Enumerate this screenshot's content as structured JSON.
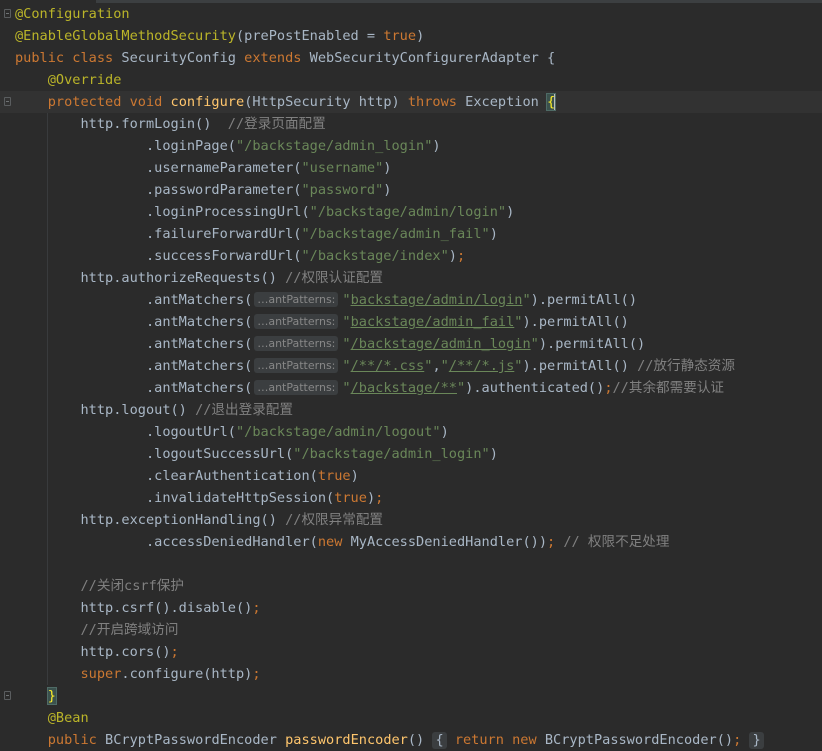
{
  "lines": [
    {
      "fold": true,
      "tokens": [
        {
          "c": "ann",
          "t": "@Configuration"
        }
      ]
    },
    {
      "fold": false,
      "tokens": [
        {
          "c": "ann",
          "t": "@EnableGlobalMethodSecurity"
        },
        {
          "c": "",
          "t": "(prePostEnabled = "
        },
        {
          "c": "kw",
          "t": "true"
        },
        {
          "c": "",
          "t": ")"
        }
      ]
    },
    {
      "fold": false,
      "tokens": [
        {
          "c": "kw",
          "t": "public class "
        },
        {
          "c": "",
          "t": "SecurityConfig "
        },
        {
          "c": "kw",
          "t": "extends "
        },
        {
          "c": "",
          "t": "WebSecurityConfigurerAdapter {"
        }
      ]
    },
    {
      "fold": false,
      "tokens": [
        {
          "c": "",
          "t": "    "
        },
        {
          "c": "ann",
          "t": "@Override"
        }
      ]
    },
    {
      "fold": true,
      "current": true,
      "tokens": [
        {
          "c": "",
          "t": "    "
        },
        {
          "c": "kw",
          "t": "protected void "
        },
        {
          "c": "fn",
          "t": "configure"
        },
        {
          "c": "",
          "t": "(HttpSecurity http) "
        },
        {
          "c": "kw",
          "t": "throws "
        },
        {
          "c": "",
          "t": "Exception "
        },
        {
          "c": "bracket-hl",
          "t": "{"
        }
      ]
    },
    {
      "fold": false,
      "tokens": [
        {
          "c": "",
          "t": "        http.formLogin()  "
        },
        {
          "c": "cmt",
          "t": "//登录页面配置"
        }
      ]
    },
    {
      "fold": false,
      "tokens": [
        {
          "c": "",
          "t": "                .loginPage("
        },
        {
          "c": "str",
          "t": "\"/backstage/admin_login\""
        },
        {
          "c": "",
          "t": ")"
        }
      ]
    },
    {
      "fold": false,
      "tokens": [
        {
          "c": "",
          "t": "                .usernameParameter("
        },
        {
          "c": "str",
          "t": "\"username\""
        },
        {
          "c": "",
          "t": ")"
        }
      ]
    },
    {
      "fold": false,
      "tokens": [
        {
          "c": "",
          "t": "                .passwordParameter("
        },
        {
          "c": "str",
          "t": "\"password\""
        },
        {
          "c": "",
          "t": ")"
        }
      ]
    },
    {
      "fold": false,
      "tokens": [
        {
          "c": "",
          "t": "                .loginProcessingUrl("
        },
        {
          "c": "str",
          "t": "\"/backstage/admin/login\""
        },
        {
          "c": "",
          "t": ")"
        }
      ]
    },
    {
      "fold": false,
      "tokens": [
        {
          "c": "",
          "t": "                .failureForwardUrl("
        },
        {
          "c": "str",
          "t": "\"/backstage/admin_fail\""
        },
        {
          "c": "",
          "t": ")"
        }
      ]
    },
    {
      "fold": false,
      "tokens": [
        {
          "c": "",
          "t": "                .successForwardUrl("
        },
        {
          "c": "str",
          "t": "\"/backstage/index\""
        },
        {
          "c": "",
          "t": ")"
        },
        {
          "c": "kw",
          "t": ";"
        }
      ]
    },
    {
      "fold": false,
      "tokens": [
        {
          "c": "",
          "t": "        http.authorizeRequests() "
        },
        {
          "c": "cmt",
          "t": "//权限认证配置"
        }
      ]
    },
    {
      "fold": false,
      "tokens": [
        {
          "c": "",
          "t": "                .antMatchers("
        },
        {
          "c": "hint",
          "t": "…antPatterns:"
        },
        {
          "c": "str",
          "t": "\""
        },
        {
          "c": "link",
          "t": "backstage/admin/login"
        },
        {
          "c": "str",
          "t": "\""
        },
        {
          "c": "",
          "t": ").permitAll()"
        }
      ]
    },
    {
      "fold": false,
      "tokens": [
        {
          "c": "",
          "t": "                .antMatchers("
        },
        {
          "c": "hint",
          "t": "…antPatterns:"
        },
        {
          "c": "str",
          "t": "\""
        },
        {
          "c": "link",
          "t": "backstage/admin_fail"
        },
        {
          "c": "str",
          "t": "\""
        },
        {
          "c": "",
          "t": ").permitAll()"
        }
      ]
    },
    {
      "fold": false,
      "tokens": [
        {
          "c": "",
          "t": "                .antMatchers("
        },
        {
          "c": "hint",
          "t": "…antPatterns:"
        },
        {
          "c": "str",
          "t": "\""
        },
        {
          "c": "link",
          "t": "/backstage/admin_login"
        },
        {
          "c": "str",
          "t": "\""
        },
        {
          "c": "",
          "t": ").permitAll()"
        }
      ]
    },
    {
      "fold": false,
      "tokens": [
        {
          "c": "",
          "t": "                .antMatchers("
        },
        {
          "c": "hint",
          "t": "…antPatterns:"
        },
        {
          "c": "str",
          "t": "\""
        },
        {
          "c": "link",
          "t": "/**/*.css"
        },
        {
          "c": "str",
          "t": "\""
        },
        {
          "c": "",
          "t": ","
        },
        {
          "c": "str",
          "t": "\""
        },
        {
          "c": "link",
          "t": "/**/*.js"
        },
        {
          "c": "str",
          "t": "\""
        },
        {
          "c": "",
          "t": ").permitAll() "
        },
        {
          "c": "cmt",
          "t": "//放行静态资源"
        }
      ]
    },
    {
      "fold": false,
      "tokens": [
        {
          "c": "",
          "t": "                .antMatchers("
        },
        {
          "c": "hint",
          "t": "…antPatterns:"
        },
        {
          "c": "str",
          "t": "\""
        },
        {
          "c": "link",
          "t": "/backstage/**"
        },
        {
          "c": "str",
          "t": "\""
        },
        {
          "c": "",
          "t": ").authenticated()"
        },
        {
          "c": "kw",
          "t": ";"
        },
        {
          "c": "cmt",
          "t": "//其余都需要认证"
        }
      ]
    },
    {
      "fold": false,
      "tokens": [
        {
          "c": "",
          "t": "        http.logout() "
        },
        {
          "c": "cmt",
          "t": "//退出登录配置"
        }
      ]
    },
    {
      "fold": false,
      "tokens": [
        {
          "c": "",
          "t": "                .logoutUrl("
        },
        {
          "c": "str",
          "t": "\"/backstage/admin/logout\""
        },
        {
          "c": "",
          "t": ")"
        }
      ]
    },
    {
      "fold": false,
      "tokens": [
        {
          "c": "",
          "t": "                .logoutSuccessUrl("
        },
        {
          "c": "str",
          "t": "\"/backstage/admin_login\""
        },
        {
          "c": "",
          "t": ")"
        }
      ]
    },
    {
      "fold": false,
      "tokens": [
        {
          "c": "",
          "t": "                .clearAuthentication("
        },
        {
          "c": "kw",
          "t": "true"
        },
        {
          "c": "",
          "t": ")"
        }
      ]
    },
    {
      "fold": false,
      "tokens": [
        {
          "c": "",
          "t": "                .invalidateHttpSession("
        },
        {
          "c": "kw",
          "t": "true"
        },
        {
          "c": "",
          "t": ")"
        },
        {
          "c": "kw",
          "t": ";"
        }
      ]
    },
    {
      "fold": false,
      "tokens": [
        {
          "c": "",
          "t": "        http.exceptionHandling() "
        },
        {
          "c": "cmt",
          "t": "//权限异常配置"
        }
      ]
    },
    {
      "fold": false,
      "tokens": [
        {
          "c": "",
          "t": "                .accessDeniedHandler("
        },
        {
          "c": "kw",
          "t": "new "
        },
        {
          "c": "",
          "t": "MyAccessDeniedHandler())"
        },
        {
          "c": "kw",
          "t": "; "
        },
        {
          "c": "cmt",
          "t": "// 权限不足处理"
        }
      ]
    },
    {
      "fold": false,
      "tokens": [
        {
          "c": "",
          "t": ""
        }
      ]
    },
    {
      "fold": false,
      "tokens": [
        {
          "c": "",
          "t": "        "
        },
        {
          "c": "cmt",
          "t": "//关闭csrf保护"
        }
      ]
    },
    {
      "fold": false,
      "tokens": [
        {
          "c": "",
          "t": "        http.csrf().disable()"
        },
        {
          "c": "kw",
          "t": ";"
        }
      ]
    },
    {
      "fold": false,
      "tokens": [
        {
          "c": "",
          "t": "        "
        },
        {
          "c": "cmt",
          "t": "//开启跨域访问"
        }
      ]
    },
    {
      "fold": false,
      "tokens": [
        {
          "c": "",
          "t": "        http.cors()"
        },
        {
          "c": "kw",
          "t": ";"
        }
      ]
    },
    {
      "fold": false,
      "tokens": [
        {
          "c": "",
          "t": "        "
        },
        {
          "c": "kw",
          "t": "super"
        },
        {
          "c": "",
          "t": ".configure(http)"
        },
        {
          "c": "kw",
          "t": ";"
        }
      ]
    },
    {
      "fold": true,
      "tokens": [
        {
          "c": "",
          "t": "    "
        },
        {
          "c": "bracket-hl",
          "t": "}"
        }
      ]
    },
    {
      "fold": false,
      "tokens": [
        {
          "c": "",
          "t": "    "
        },
        {
          "c": "ann",
          "t": "@Bean"
        }
      ]
    },
    {
      "fold": false,
      "tokens": [
        {
          "c": "",
          "t": "    "
        },
        {
          "c": "kw",
          "t": "public "
        },
        {
          "c": "",
          "t": "BCryptPasswordEncoder "
        },
        {
          "c": "fn",
          "t": "passwordEncoder"
        },
        {
          "c": "",
          "t": "() "
        },
        {
          "c": "chip",
          "t": "{"
        },
        {
          "c": "",
          "t": " "
        },
        {
          "c": "kw",
          "t": "return new "
        },
        {
          "c": "",
          "t": "BCryptPasswordEncoder()"
        },
        {
          "c": "kw",
          "t": ";"
        },
        {
          "c": "",
          "t": " "
        },
        {
          "c": "chip",
          "t": "}"
        }
      ]
    }
  ]
}
